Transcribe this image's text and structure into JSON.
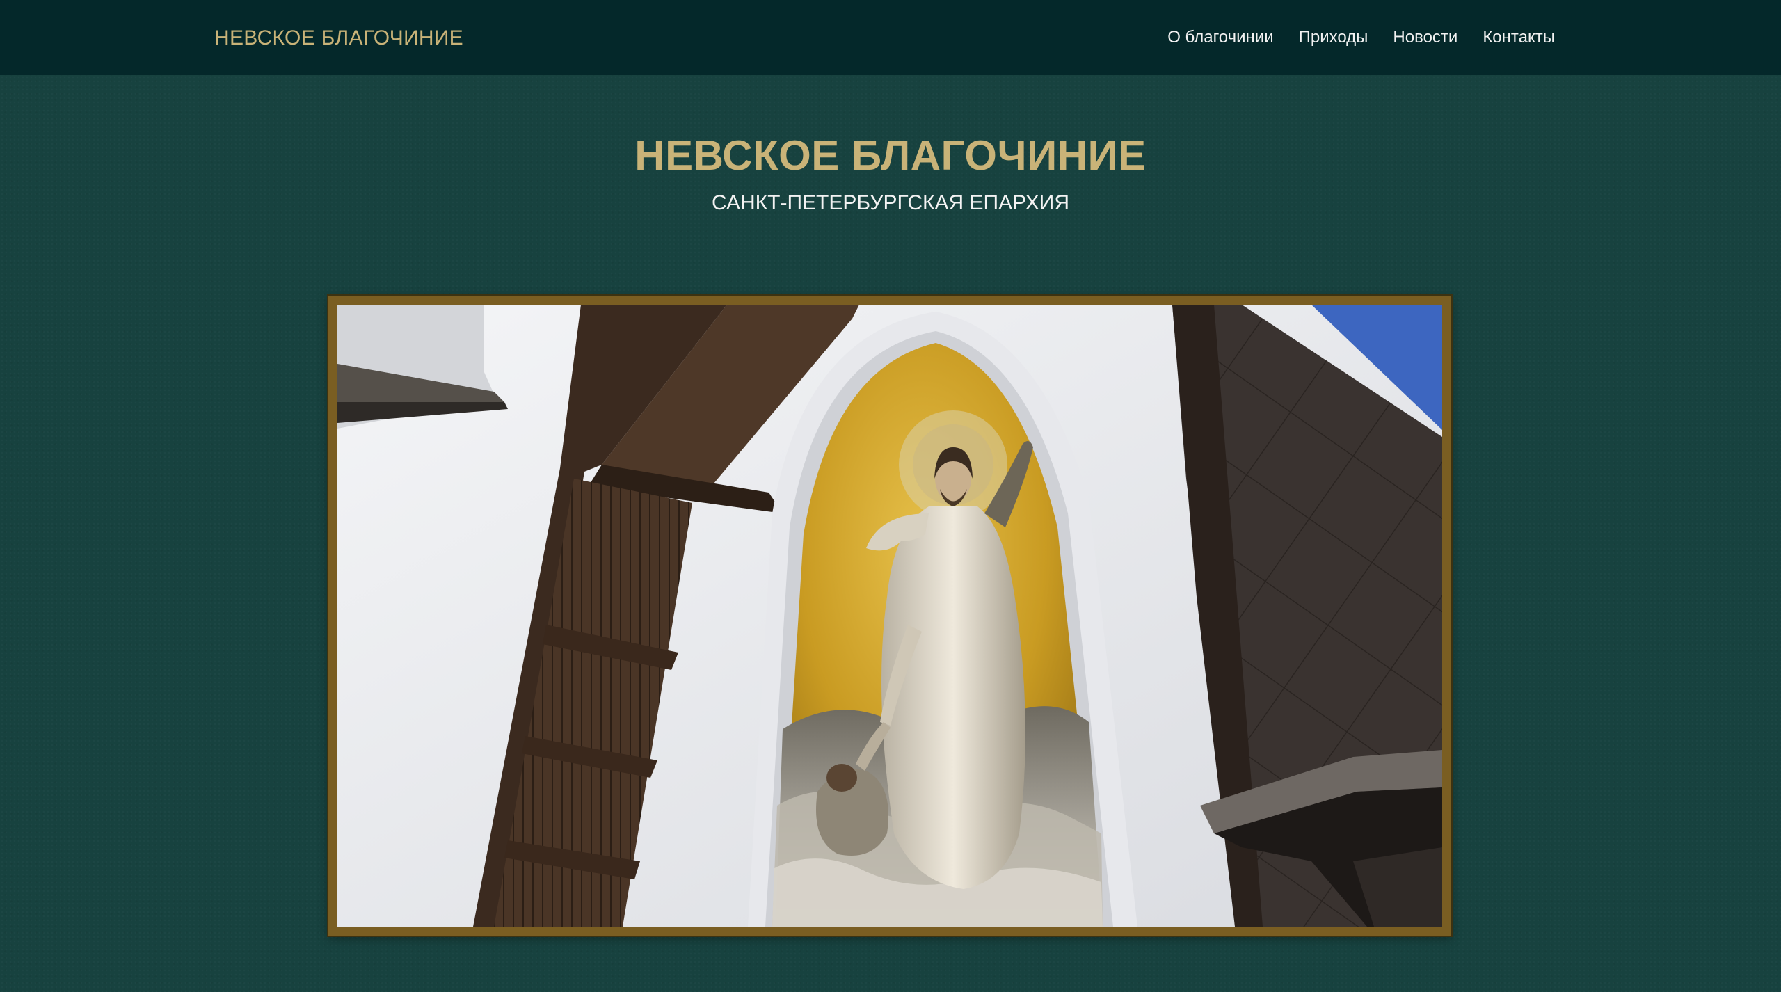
{
  "navbar": {
    "brand": "НЕВСКОЕ БЛАГОЧИНИЕ",
    "links": [
      {
        "label": "О благочинии"
      },
      {
        "label": "Приходы"
      },
      {
        "label": "Новости"
      },
      {
        "label": "Контакты"
      }
    ]
  },
  "hero": {
    "title": "НЕВСКОЕ БЛАГОЧИНИЕ",
    "subtitle": "САНКТ-ПЕТЕРБУРГСКАЯ ЕПАРХИЯ"
  },
  "colors": {
    "navbar_bg": "#04282a",
    "page_bg": "#17423f",
    "gold_text": "#c9b378",
    "frame_border": "#7a5e22"
  }
}
